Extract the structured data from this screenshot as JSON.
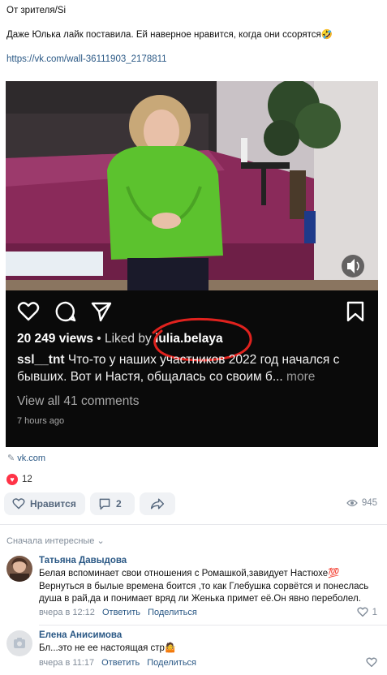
{
  "post": {
    "lines": [
      "От зрителя/Si",
      "",
      "Даже Юлька лайк поставила. Ей наверное нравится, когда они ссорятся🤣",
      "",
      "https://vk.com/wall-36111903_2178811"
    ]
  },
  "instagram": {
    "views": "20 249 views",
    "liked_by_prefix": " • Liked by ",
    "liked_by_user": "iulia.belaya",
    "caption_user": "ssl__tnt",
    "caption_text": " Что-то у наших участников 2022 год начался с бывших. Вот и Настя, общалась со своим б...",
    "more": " more",
    "comments": "View all 41 comments",
    "time": "7 hours ago"
  },
  "attachment": {
    "source": "vk.com"
  },
  "reactions": {
    "count": "12"
  },
  "actions": {
    "like_label": "Нравится",
    "comment_count": "2",
    "views_count": "945"
  },
  "comments_sort": "Сначала интересные",
  "comments": [
    {
      "author": "Татьяна Давыдова",
      "text": "Белая вспоминает свои отношения с Ромашкой,завидует Настюхе💯 Вернуться в былые времена боится ,то как Глебушка сорвётся и понеслась душа в рай,да и понимает вряд ли Женька примет её.Он явно переболел.",
      "time": "вчера в 12:12",
      "reply": "Ответить",
      "share": "Поделиться",
      "likes": "1"
    },
    {
      "author": "Елена Анисимова",
      "text": "Бл...это не ее настоящая стр🤷",
      "time": "вчера в 11:17",
      "reply": "Ответить",
      "share": "Поделиться",
      "likes": ""
    }
  ],
  "colors": {
    "link": "#2a5885",
    "muted": "#818c99",
    "heart": "#ff3347",
    "button_bg": "#f0f2f5"
  }
}
